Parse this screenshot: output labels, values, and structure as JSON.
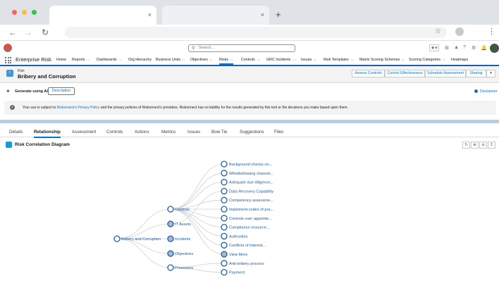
{
  "browser": {
    "tab_close_glyph": "×",
    "new_tab_glyph": "+"
  },
  "app": {
    "name": "Enterprise Risk",
    "search_placeholder": "Search...",
    "nav": [
      {
        "label": "Home",
        "chevron": false
      },
      {
        "label": "Reports",
        "chevron": true
      },
      {
        "label": "Dashboards",
        "chevron": true
      },
      {
        "label": "Org Hierarchy",
        "chevron": false
      },
      {
        "label": "Business Units",
        "chevron": true
      },
      {
        "label": "Objectives",
        "chevron": true
      },
      {
        "label": "Risks",
        "chevron": true,
        "active": true
      },
      {
        "label": "Controls",
        "chevron": true
      },
      {
        "label": "GRC Incidents",
        "chevron": true
      },
      {
        "label": "Issues",
        "chevron": true
      },
      {
        "label": "Risk Templates",
        "chevron": true
      },
      {
        "label": "Matrix Scoring Schemes",
        "chevron": true
      },
      {
        "label": "Scoring Categories",
        "chevron": true
      },
      {
        "label": "Heatmaps",
        "chevron": false
      }
    ]
  },
  "record": {
    "object_label": "Risk",
    "title": "Bribery and Corruption",
    "actions": [
      "Assess Controls",
      "Control Effectiveness",
      "Schedule Assessment",
      "Sharing"
    ]
  },
  "ai": {
    "label": "Generate using AI",
    "description_button": "Description",
    "disclaimer_link": "Disclaimer",
    "notice_prefix": "Your use is subject to ",
    "notice_link": "Riskonnect's Privacy Policy",
    "notice_suffix": " and the privacy policies of Riskonnect's providers. Riskonnect has no liability for the results generated by this tool or the decisions you make based upon them."
  },
  "tabs": [
    "Details",
    "Relationship",
    "Assessment",
    "Controls",
    "Actions",
    "Metrics",
    "Issues",
    "Bow Tie",
    "Suggestions",
    "Files"
  ],
  "active_tab": "Relationship",
  "card": {
    "title": "Risk Correlation Diagram"
  },
  "diagram": {
    "root": "Bribery and Corruption",
    "branches": [
      {
        "label": "Controls",
        "filled": false
      },
      {
        "label": "IT Assets",
        "filled": true
      },
      {
        "label": "Incidents",
        "filled": true
      },
      {
        "label": "Objectives",
        "filled": true
      },
      {
        "label": "Processes",
        "filled": false
      }
    ],
    "leaves": [
      {
        "label": "Background checks on...",
        "filled": false
      },
      {
        "label": "Whistleblowing channel...",
        "filled": false
      },
      {
        "label": "Adequate due diligence...",
        "filled": false
      },
      {
        "label": "Data Recovery Capability",
        "filled": false
      },
      {
        "label": "Competency assessme...",
        "filled": false
      },
      {
        "label": "Implement codes of pra...",
        "filled": false
      },
      {
        "label": "Controls over appointe...",
        "filled": false
      },
      {
        "label": "Compliance resource...",
        "filled": false
      },
      {
        "label": "Authorities",
        "filled": false
      },
      {
        "label": "Conflicts of interest...",
        "filled": false
      },
      {
        "label": "View More",
        "filled": true
      },
      {
        "label": "Anti-bribery process",
        "filled": false
      },
      {
        "label": "Payment",
        "filled": false
      }
    ],
    "colors": {
      "node_stroke": "#1b5fa6",
      "node_fill": "#ffffff",
      "node_filled": "#a9b8cc",
      "link": "#d0d0d0",
      "label": "#1b5fa6"
    }
  }
}
